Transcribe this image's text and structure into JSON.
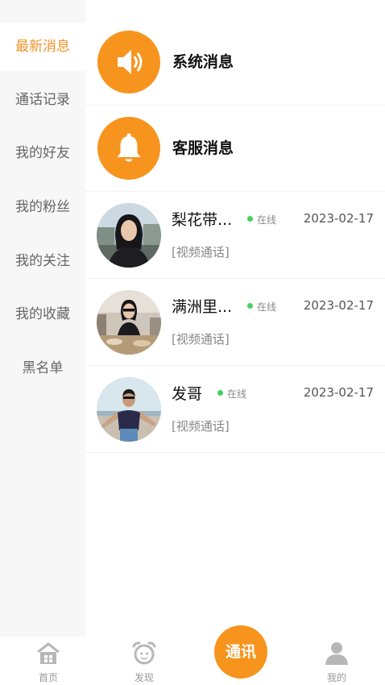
{
  "sidebar": {
    "items": [
      {
        "label": "最新消息"
      },
      {
        "label": "通话记录"
      },
      {
        "label": "我的好友"
      },
      {
        "label": "我的粉丝"
      },
      {
        "label": "我的关注"
      },
      {
        "label": "我的收藏"
      },
      {
        "label": "黑名单"
      }
    ]
  },
  "system": [
    {
      "label": "系统消息",
      "icon": "speaker-icon"
    },
    {
      "label": "客服消息",
      "icon": "bell-icon"
    }
  ],
  "chats": [
    {
      "name": "梨花带...",
      "status": "在线",
      "date": "2023-02-17",
      "preview": "[视频通话]"
    },
    {
      "name": "满洲里...",
      "status": "在线",
      "date": "2023-02-17",
      "preview": "[视频通话]"
    },
    {
      "name": "发哥",
      "status": "在线",
      "date": "2023-02-17",
      "preview": "[视频通话]"
    }
  ],
  "tabbar": {
    "home": "首页",
    "discover": "发现",
    "chat": "通讯",
    "mine": "我的"
  },
  "colors": {
    "accent": "#f7941d",
    "sidebar_active": "#f0942b",
    "online": "#44d062"
  }
}
